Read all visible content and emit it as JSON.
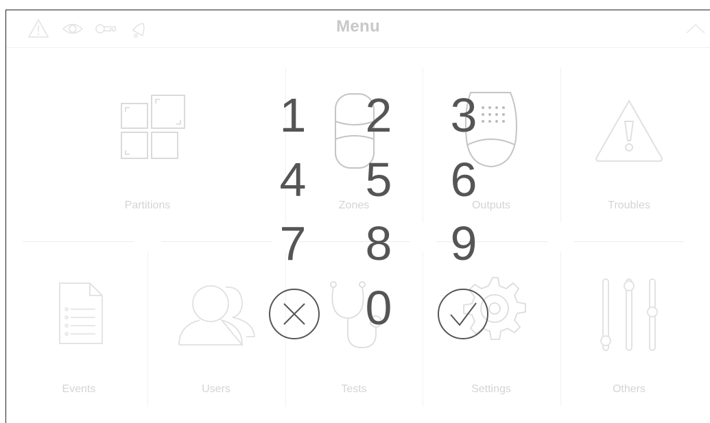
{
  "header": {
    "title": "Menu",
    "icons": [
      "warning-icon",
      "eye-icon",
      "key-icon",
      "bell-icon"
    ],
    "collapse_icon": "chevron-up-icon"
  },
  "tiles": [
    {
      "label": "Partitions",
      "icon": "partitions-icon"
    },
    {
      "label": "Zones",
      "icon": "zones-icon"
    },
    {
      "label": "Outputs",
      "icon": "outputs-icon"
    },
    {
      "label": "Troubles",
      "icon": "troubles-icon"
    },
    {
      "label": "Events",
      "icon": "events-icon"
    },
    {
      "label": "Users",
      "icon": "users-icon"
    },
    {
      "label": "Tests",
      "icon": "tests-icon"
    },
    {
      "label": "Settings",
      "icon": "settings-icon"
    },
    {
      "label": "Others",
      "icon": "others-icon"
    }
  ],
  "keypad": {
    "digits": [
      "1",
      "2",
      "3",
      "4",
      "5",
      "6",
      "7",
      "8",
      "9",
      "0"
    ],
    "cancel_icon": "cancel-icon",
    "confirm_icon": "confirm-icon"
  },
  "colors": {
    "faded_icon": "#d8d8d8",
    "keypad_text": "#555555"
  }
}
